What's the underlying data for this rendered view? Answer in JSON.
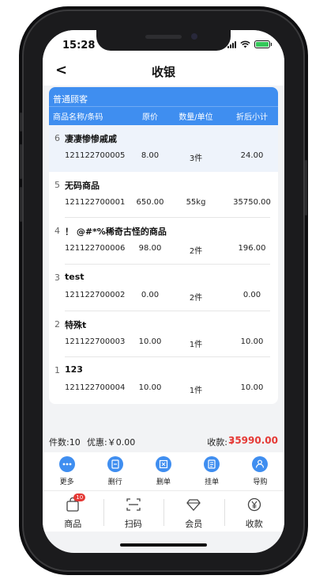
{
  "status": {
    "time": "15:28"
  },
  "nav": {
    "back": "<",
    "title": "收银"
  },
  "customer": "普通顾客",
  "columns": {
    "name": "商品名称/条码",
    "price": "原价",
    "qty": "数量/单位",
    "subtotal": "折后小计"
  },
  "items": [
    {
      "index": "6",
      "name": "凄凄惨惨戚戚",
      "barcode": "121122700005",
      "price": "8.00",
      "qty": "3件",
      "subtotal": "24.00"
    },
    {
      "index": "5",
      "name": "无码商品",
      "barcode": "121122700001",
      "price": "650.00",
      "qty": "55kg",
      "subtotal": "35750.00"
    },
    {
      "index": "4",
      "name": "！ @#*%稀奇古怪的商品",
      "barcode": "121122700006",
      "price": "98.00",
      "qty": "2件",
      "subtotal": "196.00"
    },
    {
      "index": "3",
      "name": "test",
      "barcode": "121122700002",
      "price": "0.00",
      "qty": "2件",
      "subtotal": "0.00"
    },
    {
      "index": "2",
      "name": "特殊t",
      "barcode": "121122700003",
      "price": "10.00",
      "qty": "1件",
      "subtotal": "10.00"
    },
    {
      "index": "1",
      "name": "123",
      "barcode": "121122700004",
      "price": "10.00",
      "qty": "1件",
      "subtotal": "10.00"
    }
  ],
  "summary": {
    "count": "件数:10",
    "discount": "优惠:￥0.00",
    "receivable_label": "收款:",
    "currency": "￥",
    "total": "35990.00"
  },
  "actions": {
    "more": "更多",
    "delete_row": "删行",
    "delete_order": "删单",
    "hold": "挂单",
    "guide": "导购"
  },
  "tabs": {
    "goods": "商品",
    "goods_badge": "10",
    "scan": "扫码",
    "member": "会员",
    "checkout": "收款"
  },
  "colors": {
    "primary": "#3f8ef0",
    "accent_red": "#e53935",
    "selected_row": "#eef3fb"
  }
}
